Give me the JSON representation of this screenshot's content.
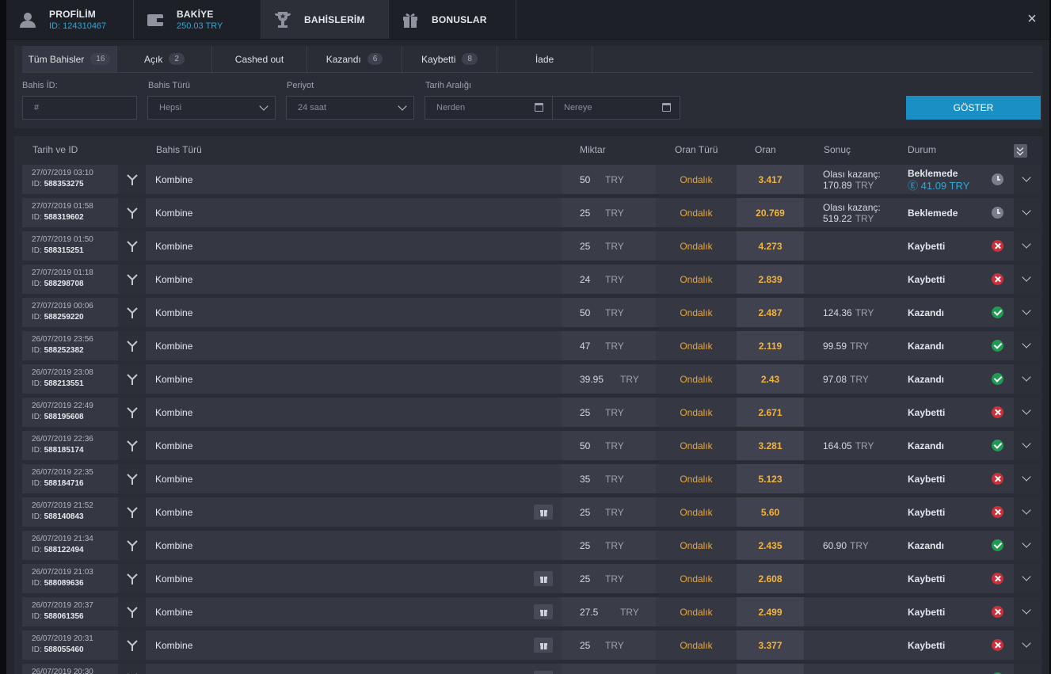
{
  "topnav": {
    "tabs": [
      {
        "title": "PROFİLİM",
        "sub": "ID: 124310467",
        "icon": "user-icon"
      },
      {
        "title": "BAKİYE",
        "sub": "250.03 TRY",
        "icon": "wallet-icon"
      },
      {
        "title": "BAHİSLERİM",
        "sub": "",
        "icon": "trophy-icon",
        "active": true
      },
      {
        "title": "BONUSLAR",
        "sub": "",
        "icon": "gift-icon"
      }
    ],
    "close_label": "×"
  },
  "subtabs": [
    {
      "label": "Tüm Bahisler",
      "count": "16",
      "active": true
    },
    {
      "label": "Açık",
      "count": "2"
    },
    {
      "label": "Cashed out",
      "count": ""
    },
    {
      "label": "Kazandı",
      "count": "6"
    },
    {
      "label": "Kaybetti",
      "count": "8"
    },
    {
      "label": "İade",
      "count": ""
    }
  ],
  "filters": {
    "bet_id_label": "Bahis İD:",
    "bet_id_placeholder": "#",
    "bet_type_label": "Bahis Türü",
    "bet_type_value": "Hepsi",
    "period_label": "Periyot",
    "period_value": "24 saat",
    "date_range_label": "Tarih Aralığı",
    "from_placeholder": "Nerden",
    "to_placeholder": "Nereye",
    "show_button": "GÖSTER"
  },
  "table": {
    "headers": {
      "date_id": "Tarih ve ID",
      "bet_type": "Bahis Türü",
      "amount": "Miktar",
      "odds_type": "Oran Türü",
      "odds": "Oran",
      "result": "Sonuç",
      "status": "Durum"
    },
    "rows": [
      {
        "date": "27/07/2019 03:10",
        "id": "588353275",
        "type": "Kombine",
        "gift": false,
        "amount": "50",
        "currency": "TRY",
        "odds_type": "Ondalık",
        "odds": "3.417",
        "result_label": "Olası kazanç:",
        "result": "170.89",
        "result_cur": "TRY",
        "status": "Beklemede",
        "cashout": "41.09 TRY",
        "state": "pending"
      },
      {
        "date": "27/07/2019 01:58",
        "id": "588319602",
        "type": "Kombine",
        "gift": false,
        "amount": "25",
        "currency": "TRY",
        "odds_type": "Ondalık",
        "odds": "20.769",
        "result_label": "Olası kazanç:",
        "result": "519.22",
        "result_cur": "TRY",
        "status": "Beklemede",
        "cashout": "",
        "state": "pending"
      },
      {
        "date": "27/07/2019 01:50",
        "id": "588315251",
        "type": "Kombine",
        "gift": false,
        "amount": "25",
        "currency": "TRY",
        "odds_type": "Ondalık",
        "odds": "4.273",
        "result_label": "",
        "result": "",
        "result_cur": "",
        "status": "Kaybetti",
        "cashout": "",
        "state": "lost"
      },
      {
        "date": "27/07/2019 01:18",
        "id": "588298708",
        "type": "Kombine",
        "gift": false,
        "amount": "24",
        "currency": "TRY",
        "odds_type": "Ondalık",
        "odds": "2.839",
        "result_label": "",
        "result": "",
        "result_cur": "",
        "status": "Kaybetti",
        "cashout": "",
        "state": "lost"
      },
      {
        "date": "27/07/2019 00:06",
        "id": "588259220",
        "type": "Kombine",
        "gift": false,
        "amount": "50",
        "currency": "TRY",
        "odds_type": "Ondalık",
        "odds": "2.487",
        "result_label": "",
        "result": "124.36",
        "result_cur": "TRY",
        "status": "Kazandı",
        "cashout": "",
        "state": "won"
      },
      {
        "date": "26/07/2019 23:56",
        "id": "588252382",
        "type": "Kombine",
        "gift": false,
        "amount": "47",
        "currency": "TRY",
        "odds_type": "Ondalık",
        "odds": "2.119",
        "result_label": "",
        "result": "99.59",
        "result_cur": "TRY",
        "status": "Kazandı",
        "cashout": "",
        "state": "won"
      },
      {
        "date": "26/07/2019 23:08",
        "id": "588213551",
        "type": "Kombine",
        "gift": false,
        "amount": "39.95",
        "currency": "TRY",
        "odds_type": "Ondalık",
        "odds": "2.43",
        "result_label": "",
        "result": "97.08",
        "result_cur": "TRY",
        "status": "Kazandı",
        "cashout": "",
        "state": "won"
      },
      {
        "date": "26/07/2019 22:49",
        "id": "588195608",
        "type": "Kombine",
        "gift": false,
        "amount": "25",
        "currency": "TRY",
        "odds_type": "Ondalık",
        "odds": "2.671",
        "result_label": "",
        "result": "",
        "result_cur": "",
        "status": "Kaybetti",
        "cashout": "",
        "state": "lost"
      },
      {
        "date": "26/07/2019 22:36",
        "id": "588185174",
        "type": "Kombine",
        "gift": false,
        "amount": "50",
        "currency": "TRY",
        "odds_type": "Ondalık",
        "odds": "3.281",
        "result_label": "",
        "result": "164.05",
        "result_cur": "TRY",
        "status": "Kazandı",
        "cashout": "",
        "state": "won"
      },
      {
        "date": "26/07/2019 22:35",
        "id": "588184716",
        "type": "Kombine",
        "gift": false,
        "amount": "35",
        "currency": "TRY",
        "odds_type": "Ondalık",
        "odds": "5.123",
        "result_label": "",
        "result": "",
        "result_cur": "",
        "status": "Kaybetti",
        "cashout": "",
        "state": "lost"
      },
      {
        "date": "26/07/2019 21:52",
        "id": "588140843",
        "type": "Kombine",
        "gift": true,
        "amount": "25",
        "currency": "TRY",
        "odds_type": "Ondalık",
        "odds": "5.60",
        "result_label": "",
        "result": "",
        "result_cur": "",
        "status": "Kaybetti",
        "cashout": "",
        "state": "lost"
      },
      {
        "date": "26/07/2019 21:34",
        "id": "588122494",
        "type": "Kombine",
        "gift": false,
        "amount": "25",
        "currency": "TRY",
        "odds_type": "Ondalık",
        "odds": "2.435",
        "result_label": "",
        "result": "60.90",
        "result_cur": "TRY",
        "status": "Kazandı",
        "cashout": "",
        "state": "won"
      },
      {
        "date": "26/07/2019 21:03",
        "id": "588089636",
        "type": "Kombine",
        "gift": true,
        "amount": "25",
        "currency": "TRY",
        "odds_type": "Ondalık",
        "odds": "2.608",
        "result_label": "",
        "result": "",
        "result_cur": "",
        "status": "Kaybetti",
        "cashout": "",
        "state": "lost"
      },
      {
        "date": "26/07/2019 20:37",
        "id": "588061356",
        "type": "Kombine",
        "gift": true,
        "amount": "27.5",
        "currency": "TRY",
        "odds_type": "Ondalık",
        "odds": "2.499",
        "result_label": "",
        "result": "",
        "result_cur": "",
        "status": "Kaybetti",
        "cashout": "",
        "state": "lost"
      },
      {
        "date": "26/07/2019 20:31",
        "id": "588055460",
        "type": "Kombine",
        "gift": true,
        "amount": "25",
        "currency": "TRY",
        "odds_type": "Ondalık",
        "odds": "3.377",
        "result_label": "",
        "result": "",
        "result_cur": "",
        "status": "Kaybetti",
        "cashout": "",
        "state": "lost"
      },
      {
        "date": "26/07/2019 20:30",
        "id": "",
        "type": "",
        "gift": true,
        "amount": "",
        "currency": "",
        "odds_type": "",
        "odds": "",
        "result_label": "",
        "result": "",
        "result_cur": "",
        "status": "",
        "cashout": "",
        "state": "won"
      }
    ]
  },
  "colors": {
    "accent": "#1a8fc4",
    "odds": "#f3b43c",
    "won": "#1e9a52",
    "lost": "#c9303a"
  }
}
